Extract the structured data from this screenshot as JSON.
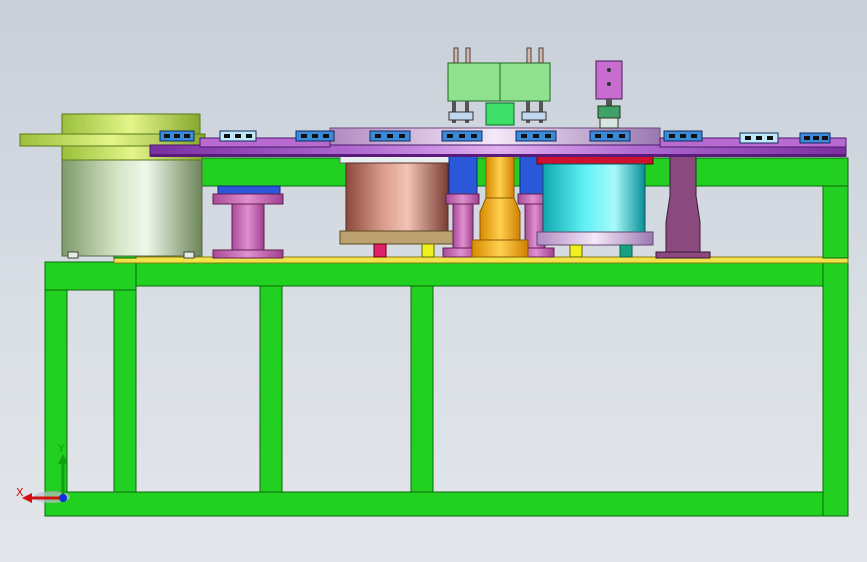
{
  "viewport": {
    "background_top": "#c8cfd8",
    "background_bottom": "#e3e6ea"
  },
  "colors": {
    "frame_green": "#22d022",
    "frame_outline": "#0a6a0a",
    "table_top": "#f2e24a",
    "purple_plate": "#9a3fb5",
    "pink_part": "#c86cb6",
    "orange_column": "#f7b21a",
    "copper_cylinder": "#c97a6c",
    "cyan_cylinder": "#25d7de",
    "light_green_block": "#8fe08f",
    "olive_feeder": "#a8d44a",
    "blue_part": "#2a58d8"
  },
  "triad": {
    "x_label": "X",
    "y_label": "Y",
    "x_icon": "x-axis-arrow-icon",
    "y_icon": "y-axis-arrow-icon",
    "z_icon": "z-axis-origin-icon"
  }
}
